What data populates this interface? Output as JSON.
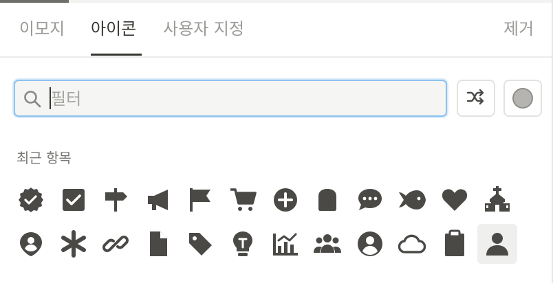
{
  "tabs": [
    {
      "label": "이모지"
    },
    {
      "label": "아이콘"
    },
    {
      "label": "사용자 지정"
    }
  ],
  "remove_label": "제거",
  "search": {
    "placeholder": "필터",
    "value": ""
  },
  "section_title": "최근 항목",
  "selected_color": "#b5b4b1",
  "icon_color": "#4a4946",
  "icons": [
    "badge-check-icon",
    "checkbox-icon",
    "signpost-icon",
    "megaphone-icon",
    "flag-icon",
    "cart-icon",
    "plus-circle-icon",
    "bread-icon",
    "chat-dots-icon",
    "fish-icon",
    "heart-icon",
    "church-icon",
    "map-pin-person-icon",
    "asterisk-icon",
    "link-icon",
    "document-icon",
    "tag-icon",
    "lightbulb-icon",
    "chart-icon",
    "people-icon",
    "user-circle-icon",
    "cloud-icon",
    "clipboard-icon",
    "person-icon"
  ]
}
